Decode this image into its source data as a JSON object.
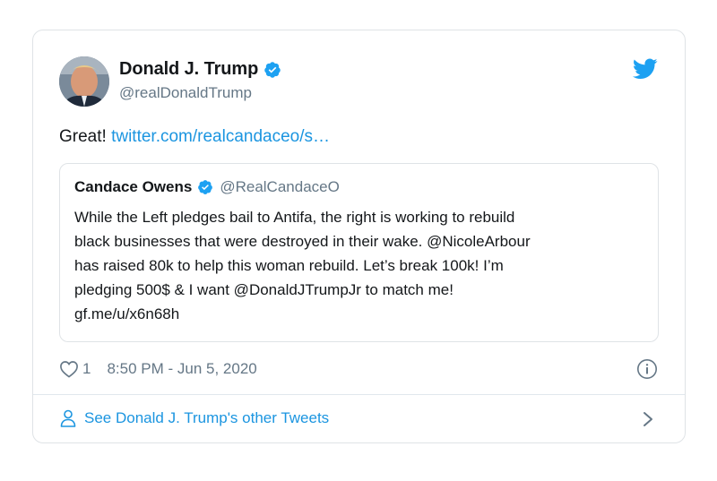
{
  "author": {
    "display_name": "Donald J. Trump",
    "handle": "@realDonaldTrump"
  },
  "tweet": {
    "text_prefix": "Great! ",
    "link_text": "twitter.com/realcandaceo/s…"
  },
  "quoted_tweet": {
    "display_name": "Candace Owens",
    "handle": "@RealCandaceO",
    "lines": [
      "While the Left pledges bail to Antifa, the right is working to rebuild",
      "black businesses that were destroyed in their wake. @NicoleArbour",
      "has raised 80k to help this woman rebuild. Let’s break 100k! I’m",
      "pledging 500$ & I want @DonaldJTrumpJr to match me!",
      "gf.me/u/x6n68h"
    ]
  },
  "meta": {
    "like_count": "1",
    "timestamp": "8:50 PM - Jun 5, 2020"
  },
  "footer": {
    "label": "See Donald J. Trump's other Tweets"
  },
  "colors": {
    "accent": "#1b95e0",
    "verified": "#1da1f2",
    "muted": "#657786",
    "border": "#dfe3e6"
  },
  "icons": [
    "verified-badge-icon",
    "twitter-bird-icon",
    "heart-icon",
    "info-icon",
    "person-icon",
    "chevron-right-icon"
  ]
}
